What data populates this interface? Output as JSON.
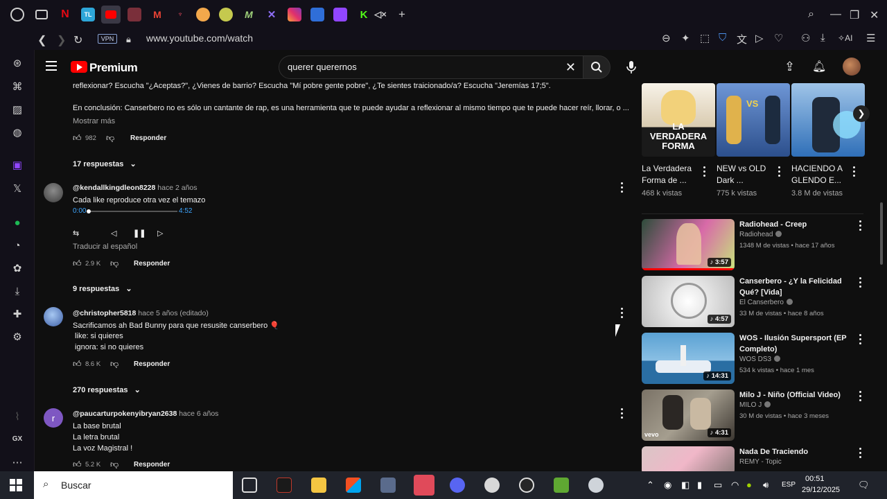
{
  "browser": {
    "url": "www.youtube.com/watch",
    "vpn_label": "VPN",
    "ai_label": "AI",
    "tab_letters": [
      "TL",
      "M"
    ]
  },
  "youtube": {
    "brand": "Premium",
    "search_value": "querer querernos"
  },
  "comments": {
    "top_partial_line1": "reflexionar? Escucha \"¿Aceptas?\", ¿Vienes de barrio? Escucha \"Mí pobre gente pobre\", ¿Te sientes traicionado/a? Escucha \"Jeremías 17;5\".",
    "top_partial_line2": "En conclusión: Canserbero no es sólo un cantante de rap, es una herramienta que te puede ayudar a reflexionar al mismo tiempo que te puede hacer reír, llorar, o ...",
    "show_more": "Mostrar más",
    "top_likes": "982",
    "reply_label": "Responder",
    "top_replies": "17 respuestas",
    "items": [
      {
        "author": "@kendallkingdleon8228",
        "when": "hace 2 años",
        "lines": [
          "Cada like reproduce otra vez el temazo"
        ],
        "time_start": "0:00",
        "time_end": "4:52",
        "progress": 0.0,
        "translate": "Traducir al español",
        "likes": "2.9 K",
        "replies": "9 respuestas"
      },
      {
        "author": "@christopher5818",
        "when": "hace 5 años (editado)",
        "lines": [
          "Sacrificamos ah Bad Bunny para que resusite canserbero 🎈",
          " like: si quieres",
          " ignora: si no quieres"
        ],
        "likes": "8.6 K",
        "replies": "270 respuestas"
      },
      {
        "author": "@paucarturpokenyibryan2638",
        "when": "hace 6 años",
        "avatar_letter": "r",
        "lines": [
          "La base brutal",
          "La letra brutal",
          "La voz Magistral !"
        ],
        "likes": "5.2 K"
      }
    ]
  },
  "shorts": [
    {
      "title": "La Verdadera Forma de ...",
      "views": "468 k vistas",
      "thumb_text": "LA VERDADERA FORMA",
      "thumb_color": "#f4f1ea"
    },
    {
      "title": "NEW vs OLD Dark ...",
      "views": "775 k vistas",
      "thumb_text": "VS",
      "thumb_color": "#4a6fb0"
    },
    {
      "title": "HACIENDO A GLENDO E...",
      "views": "3.8 M de vistas",
      "thumb_text": "",
      "thumb_color": "#3b80c9"
    }
  ],
  "videos": [
    {
      "title": "Radiohead - Creep",
      "channel": "Radiohead",
      "meta": "1348 M de vistas • hace 17 años",
      "duration": "3:57",
      "thumb": [
        "#2d4c3a",
        "#d86aa8",
        "#c7e37b"
      ]
    },
    {
      "title": "Canserbero - ¿Y la Felicidad Qué? [Vida]",
      "channel": "El Canserbero",
      "meta": "33 M de vistas • hace 8 años",
      "duration": "4:57",
      "thumb": [
        "#e8e8e8",
        "#c8c8c8",
        "#f5f5f5"
      ]
    },
    {
      "title": "WOS - Ilusión Supersport (EP Completo)",
      "channel": "WOS DS3",
      "meta": "534 k vistas • hace 1 mes",
      "duration": "14:31",
      "thumb": [
        "#5aa1d3",
        "#2a6ea3",
        "#c7d9e6"
      ]
    },
    {
      "title": "Milo J - Niño (Official Video)",
      "channel": "MILO J",
      "meta": "30 M de vistas • hace 3 meses",
      "duration": "4:31",
      "thumb": [
        "#7a7266",
        "#a59e8f",
        "#3b3630"
      ],
      "badge": "vevo"
    },
    {
      "title": "Nada De Traciendo",
      "channel": "REMY - Topic",
      "meta": "",
      "duration": "",
      "thumb": [
        "#d9c6c6",
        "#f0b7c8",
        "#8d7b7b"
      ]
    }
  ],
  "taskbar": {
    "search_placeholder": "Buscar",
    "lang": "ESP",
    "time": "00:51",
    "date": "29/12/2025"
  },
  "rail": {
    "gx_label": "GX"
  },
  "colors": {
    "accent_blue": "#3ea6ff",
    "yt_red": "#ff0000"
  }
}
